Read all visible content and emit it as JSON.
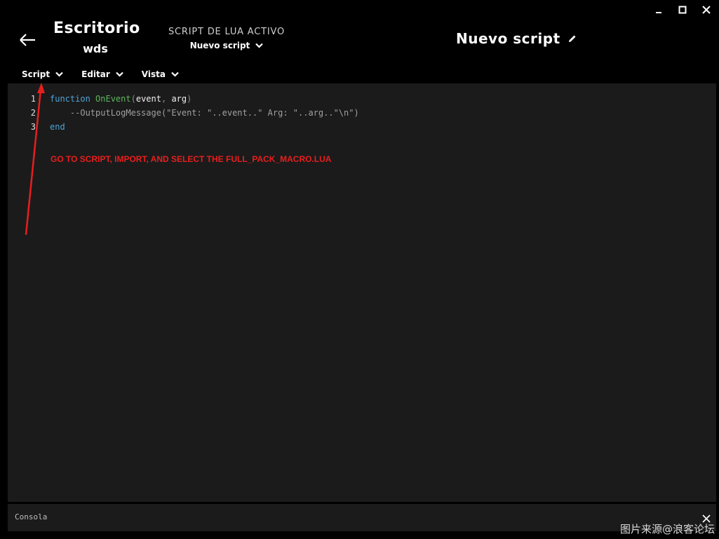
{
  "window": {
    "controls": [
      "minimize-icon",
      "maximize-icon",
      "close-icon"
    ]
  },
  "header": {
    "back_icon": "arrow-left-icon",
    "profile_name": "Escritorio",
    "profile_sub": "wds",
    "active_script_label": "SCRIPT DE LUA ACTIVO",
    "active_script_value": "Nuevo script",
    "script_title": "Nuevo script",
    "edit_icon": "pencil-icon"
  },
  "menubar": {
    "items": [
      {
        "label": "Script"
      },
      {
        "label": "Editar"
      },
      {
        "label": "Vista"
      }
    ]
  },
  "editor": {
    "line_numbers": [
      "1",
      "2",
      "3"
    ],
    "line1": {
      "kw": "function",
      "fn": "OnEvent",
      "open": "(",
      "a1": "event",
      "comma": ",",
      "a2": "arg",
      "close": ")"
    },
    "line2": "    --OutputLogMessage(\"Event: \"..event..\" Arg: \"..arg..\"\\n\")",
    "line3": "end",
    "annotation": "GO TO SCRIPT, IMPORT, AND SELECT THE FULL_PACK_MACRO.LUA",
    "colors": {
      "keyword": "#4fa3d8",
      "function": "#5cb85c",
      "annotation": "#e81e1e"
    }
  },
  "console": {
    "label": "Consola",
    "close_icon": "close-icon"
  },
  "watermark": "图片来源@浪客论坛"
}
